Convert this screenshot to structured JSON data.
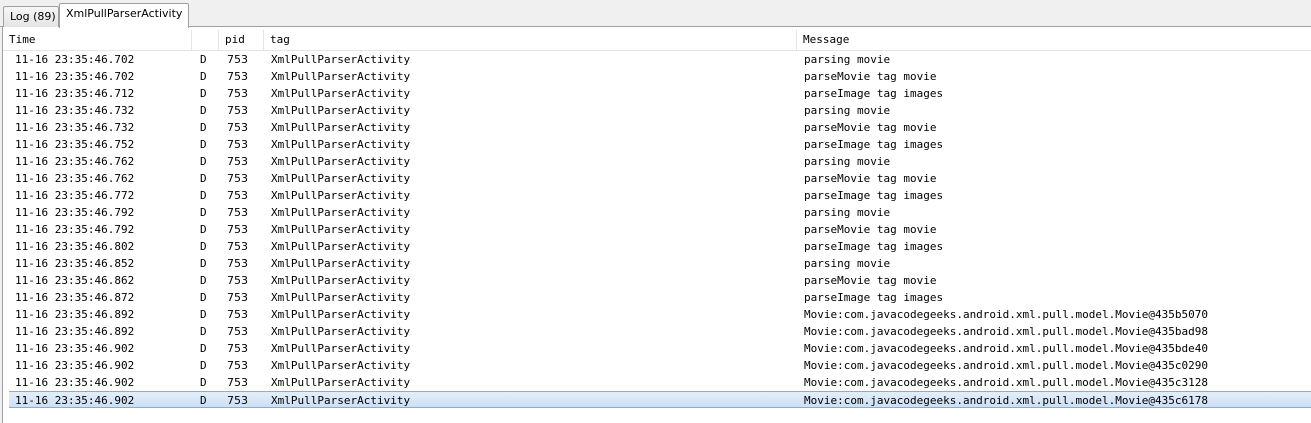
{
  "tabs": [
    {
      "label": "Log (89)",
      "active": false
    },
    {
      "label": "XmlPullParserActivity",
      "active": true
    }
  ],
  "columns": {
    "time": "Time",
    "level": "",
    "pid": "pid",
    "tag": "tag",
    "message": "Message"
  },
  "selected_row_index": 20,
  "colors": {
    "selection_top": "#e3eefb",
    "selection_bottom": "#cde0f6",
    "selection_border": "#84acdd"
  },
  "rows": [
    {
      "time": "11-16 23:35:46.702",
      "level": "D",
      "pid": "753",
      "tag": "XmlPullParserActivity",
      "message": "parsing movie"
    },
    {
      "time": "11-16 23:35:46.702",
      "level": "D",
      "pid": "753",
      "tag": "XmlPullParserActivity",
      "message": "parseMovie tag movie"
    },
    {
      "time": "11-16 23:35:46.712",
      "level": "D",
      "pid": "753",
      "tag": "XmlPullParserActivity",
      "message": "parseImage tag images"
    },
    {
      "time": "11-16 23:35:46.732",
      "level": "D",
      "pid": "753",
      "tag": "XmlPullParserActivity",
      "message": "parsing movie"
    },
    {
      "time": "11-16 23:35:46.732",
      "level": "D",
      "pid": "753",
      "tag": "XmlPullParserActivity",
      "message": "parseMovie tag movie"
    },
    {
      "time": "11-16 23:35:46.752",
      "level": "D",
      "pid": "753",
      "tag": "XmlPullParserActivity",
      "message": "parseImage tag images"
    },
    {
      "time": "11-16 23:35:46.762",
      "level": "D",
      "pid": "753",
      "tag": "XmlPullParserActivity",
      "message": "parsing movie"
    },
    {
      "time": "11-16 23:35:46.762",
      "level": "D",
      "pid": "753",
      "tag": "XmlPullParserActivity",
      "message": "parseMovie tag movie"
    },
    {
      "time": "11-16 23:35:46.772",
      "level": "D",
      "pid": "753",
      "tag": "XmlPullParserActivity",
      "message": "parseImage tag images"
    },
    {
      "time": "11-16 23:35:46.792",
      "level": "D",
      "pid": "753",
      "tag": "XmlPullParserActivity",
      "message": "parsing movie"
    },
    {
      "time": "11-16 23:35:46.792",
      "level": "D",
      "pid": "753",
      "tag": "XmlPullParserActivity",
      "message": "parseMovie tag movie"
    },
    {
      "time": "11-16 23:35:46.802",
      "level": "D",
      "pid": "753",
      "tag": "XmlPullParserActivity",
      "message": "parseImage tag images"
    },
    {
      "time": "11-16 23:35:46.852",
      "level": "D",
      "pid": "753",
      "tag": "XmlPullParserActivity",
      "message": "parsing movie"
    },
    {
      "time": "11-16 23:35:46.862",
      "level": "D",
      "pid": "753",
      "tag": "XmlPullParserActivity",
      "message": "parseMovie tag movie"
    },
    {
      "time": "11-16 23:35:46.872",
      "level": "D",
      "pid": "753",
      "tag": "XmlPullParserActivity",
      "message": "parseImage tag images"
    },
    {
      "time": "11-16 23:35:46.892",
      "level": "D",
      "pid": "753",
      "tag": "XmlPullParserActivity",
      "message": "Movie:com.javacodegeeks.android.xml.pull.model.Movie@435b5070"
    },
    {
      "time": "11-16 23:35:46.892",
      "level": "D",
      "pid": "753",
      "tag": "XmlPullParserActivity",
      "message": "Movie:com.javacodegeeks.android.xml.pull.model.Movie@435bad98"
    },
    {
      "time": "11-16 23:35:46.902",
      "level": "D",
      "pid": "753",
      "tag": "XmlPullParserActivity",
      "message": "Movie:com.javacodegeeks.android.xml.pull.model.Movie@435bde40"
    },
    {
      "time": "11-16 23:35:46.902",
      "level": "D",
      "pid": "753",
      "tag": "XmlPullParserActivity",
      "message": "Movie:com.javacodegeeks.android.xml.pull.model.Movie@435c0290"
    },
    {
      "time": "11-16 23:35:46.902",
      "level": "D",
      "pid": "753",
      "tag": "XmlPullParserActivity",
      "message": "Movie:com.javacodegeeks.android.xml.pull.model.Movie@435c3128"
    },
    {
      "time": "11-16 23:35:46.902",
      "level": "D",
      "pid": "753",
      "tag": "XmlPullParserActivity",
      "message": "Movie:com.javacodegeeks.android.xml.pull.model.Movie@435c6178"
    }
  ]
}
